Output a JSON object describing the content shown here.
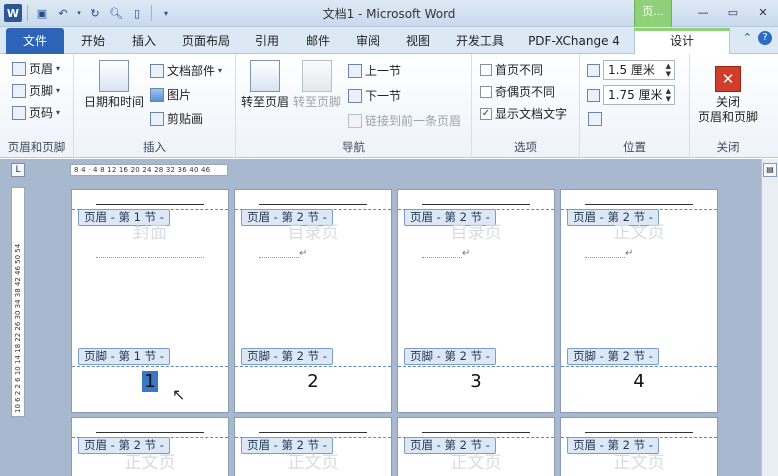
{
  "app": {
    "title": "文档1 - Microsoft Word",
    "context_tab": "页...",
    "qat_logo": "W"
  },
  "tabs": [
    "文件",
    "开始",
    "插入",
    "页面布局",
    "引用",
    "邮件",
    "审阅",
    "视图",
    "开发工具",
    "PDF-XChange 4",
    "设计"
  ],
  "ribbon": {
    "groups": {
      "header_footer": {
        "label": "页眉和页脚",
        "items": [
          "页眉",
          "页脚",
          "页码"
        ]
      },
      "insert": {
        "label": "插入",
        "datetime": "日期和时间",
        "doc_parts": "文档部件",
        "picture": "图片",
        "clipart": "剪贴画"
      },
      "navigation": {
        "label": "导航",
        "goto_header": "转至页眉",
        "goto_footer": "转至页脚",
        "prev_section": "上一节",
        "next_section": "下一节",
        "link_previous": "链接到前一条页眉"
      },
      "options": {
        "label": "选项",
        "first_page_diff": "首页不同",
        "odd_even_diff": "奇偶页不同",
        "show_doc_text": "显示文档文字",
        "first_page_checked": false,
        "odd_even_checked": false,
        "show_doc_text_checked": true
      },
      "position": {
        "label": "位置",
        "header_distance": "1.5 厘米",
        "footer_distance": "1.75 厘米"
      },
      "close": {
        "label": "关闭",
        "button_line1": "关闭",
        "button_line2": "页眉和页脚"
      }
    }
  },
  "ruler": {
    "horizontal": "8 4 · 4 8 12 16 20 24 28 32 36 40 46",
    "vertical": "10 6 2 2 6 10 14 18 22 26 30 34 38 42 46 50 54",
    "corner": "L"
  },
  "pages": [
    {
      "header_label": "页眉 - 第 1 节 -",
      "footer_label": "页脚 - 第 1 节 -",
      "ghost_text": "封面",
      "page_number": "1",
      "selected": true
    },
    {
      "header_label": "页眉 - 第 2 节 -",
      "footer_label": "页脚 - 第 2 节 -",
      "ghost_text": "目录页",
      "page_number": "2",
      "selected": false
    },
    {
      "header_label": "页眉 - 第 2 节 -",
      "footer_label": "页脚 - 第 2 节 -",
      "ghost_text": "目录页",
      "page_number": "3",
      "selected": false
    },
    {
      "header_label": "页眉 - 第 2 节 -",
      "footer_label": "页脚 - 第 2 节 -",
      "ghost_text": "正文页",
      "page_number": "4",
      "selected": false
    },
    {
      "header_label": "页眉 - 第 2 节 -",
      "ghost_text": "正文页"
    },
    {
      "header_label": "页眉 - 第 2 节 -",
      "ghost_text": "正文页"
    },
    {
      "header_label": "页眉 - 第 2 节 -",
      "ghost_text": "正文页"
    },
    {
      "header_label": "页眉 - 第 2 节 -",
      "ghost_text": "正文页"
    }
  ],
  "paragraph_mark": "↵"
}
